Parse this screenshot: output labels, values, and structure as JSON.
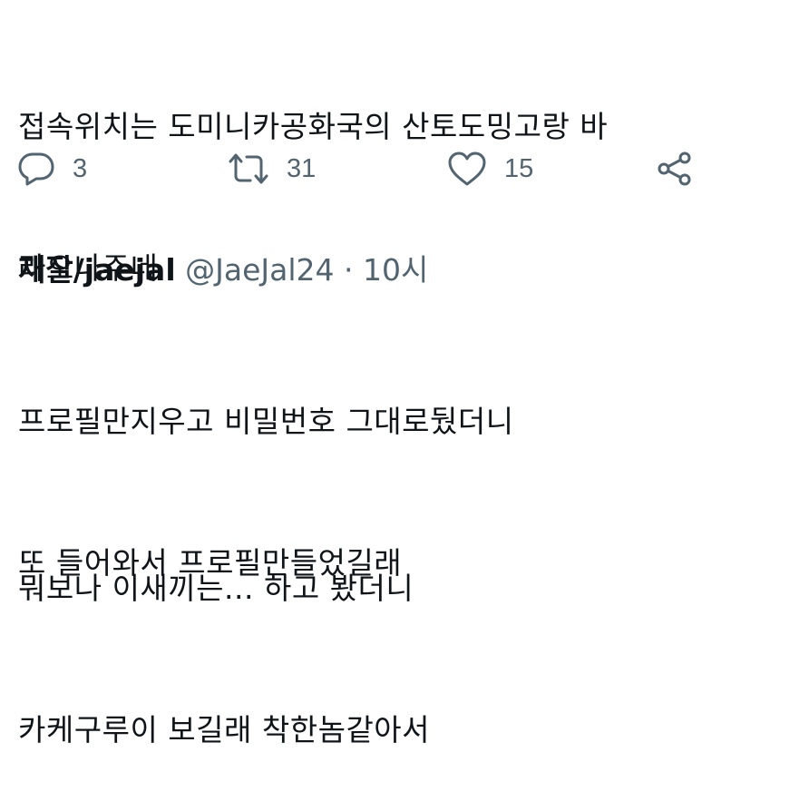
{
  "previous_tweet": {
    "text_lines": [
      "접속위치는 도미니카공화국의 산토도밍고랑 바",
      "라오나주네"
    ],
    "actions": {
      "reply_count": "3",
      "retweet_count": "31",
      "like_count": "15"
    }
  },
  "reply_tweet": {
    "display_name": "재잘/jaejal",
    "handle": "@JaeJal24",
    "separator": "·",
    "time": "10시",
    "text_lines": [
      "프로필만지우고 비밀번호 그대로뒀더니",
      "또 들어와서 프로필만들었길래",
      "뭐보나 이새끼는... 하고 봤더니",
      "카케구루이 보길래 착한놈같아서"
    ]
  },
  "icons": {
    "reply": "reply-icon",
    "retweet": "retweet-icon",
    "like": "heart-icon",
    "share": "share-icon"
  },
  "colors": {
    "text": "#0f1419",
    "secondary": "#536471",
    "background": "#ffffff"
  }
}
